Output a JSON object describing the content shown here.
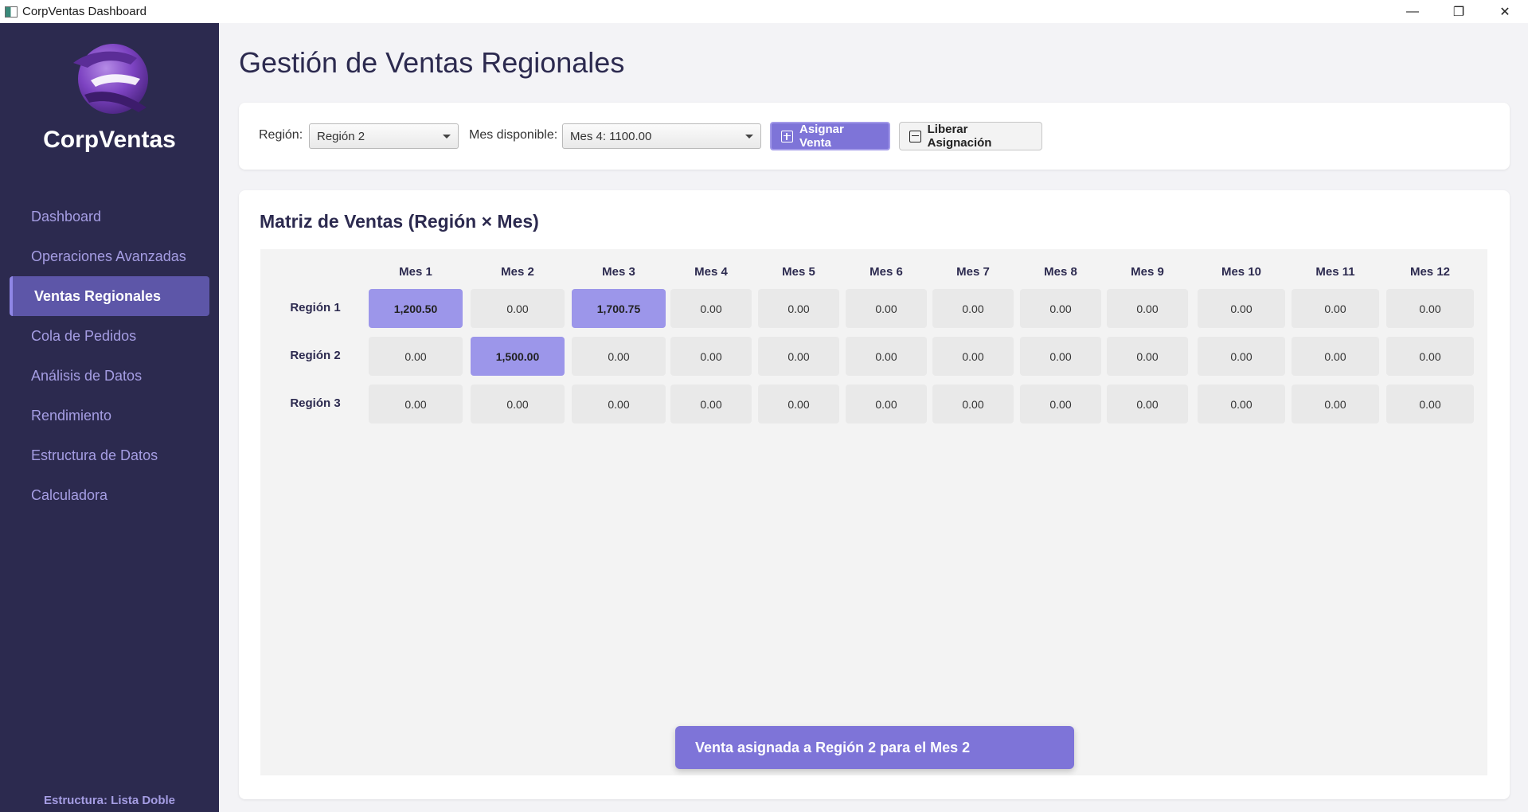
{
  "window": {
    "title": "CorpVentas Dashboard"
  },
  "sidebar": {
    "brand": "CorpVentas",
    "items": [
      {
        "label": "Dashboard"
      },
      {
        "label": "Operaciones Avanzadas"
      },
      {
        "label": "Ventas Regionales",
        "active": true
      },
      {
        "label": "Cola de Pedidos"
      },
      {
        "label": "Análisis de Datos"
      },
      {
        "label": "Rendimiento"
      },
      {
        "label": "Estructura de Datos"
      },
      {
        "label": "Calculadora"
      }
    ],
    "footer": "Estructura: Lista Doble"
  },
  "page": {
    "title": "Gestión de Ventas Regionales"
  },
  "toolbar": {
    "region_label": "Región:",
    "region_value": "Región 2",
    "month_label": "Mes disponible:",
    "month_value": "Mes 4: 1100.00",
    "assign_label": "Asignar Venta",
    "release_label": "Liberar Asignación"
  },
  "matrix": {
    "title": "Matriz de Ventas (Región × Mes)",
    "columns": [
      "Mes 1",
      "Mes 2",
      "Mes 3",
      "Mes 4",
      "Mes 5",
      "Mes 6",
      "Mes 7",
      "Mes 8",
      "Mes 9",
      "Mes 10",
      "Mes 11",
      "Mes 12"
    ],
    "rows": [
      {
        "label": "Región 1",
        "values": [
          "1,200.50",
          "0.00",
          "1,700.75",
          "0.00",
          "0.00",
          "0.00",
          "0.00",
          "0.00",
          "0.00",
          "0.00",
          "0.00",
          "0.00"
        ],
        "filled": [
          0,
          2
        ]
      },
      {
        "label": "Región 2",
        "values": [
          "0.00",
          "1,500.00",
          "0.00",
          "0.00",
          "0.00",
          "0.00",
          "0.00",
          "0.00",
          "0.00",
          "0.00",
          "0.00",
          "0.00"
        ],
        "filled": [
          1
        ]
      },
      {
        "label": "Región 3",
        "values": [
          "0.00",
          "0.00",
          "0.00",
          "0.00",
          "0.00",
          "0.00",
          "0.00",
          "0.00",
          "0.00",
          "0.00",
          "0.00",
          "0.00"
        ],
        "filled": []
      }
    ]
  },
  "toast": {
    "message": "Venta asignada a Región 2 para el Mes 2"
  },
  "colors": {
    "sidebar": "#2c2a4f",
    "accent": "#7e74d8",
    "filled_cell": "#9c96ea",
    "nav_text": "#a59de3"
  }
}
